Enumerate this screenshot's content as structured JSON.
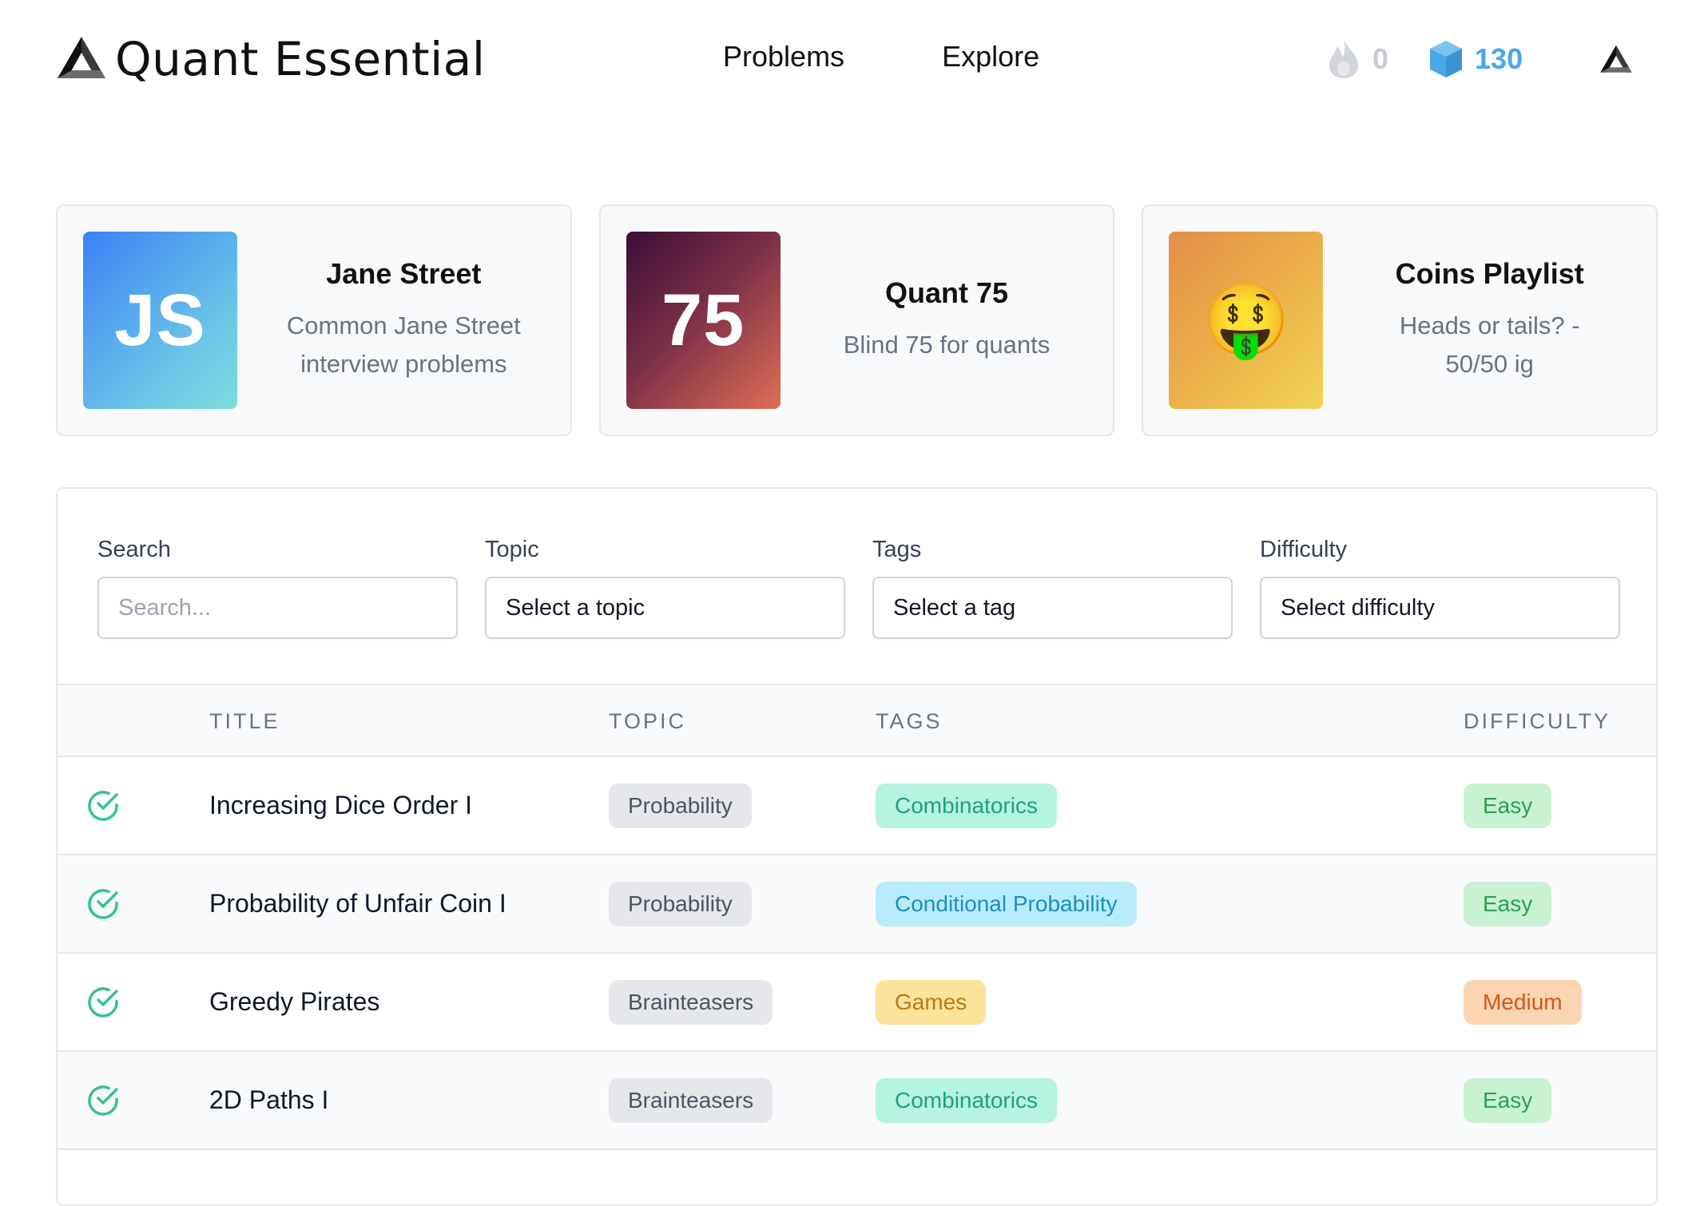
{
  "brand": {
    "name": "Quant Essential"
  },
  "nav": {
    "problems": "Problems",
    "explore": "Explore"
  },
  "stats": {
    "streak": "0",
    "gems": "130"
  },
  "cards": [
    {
      "thumb_text": "JS",
      "title": "Jane Street",
      "desc_line1": "Common Jane Street",
      "desc_line2": "interview problems"
    },
    {
      "thumb_text": "75",
      "title": "Quant 75",
      "desc_line1": "Blind 75 for quants",
      "desc_line2": ""
    },
    {
      "thumb_text": "🤑",
      "title": "Coins Playlist",
      "desc_line1": "Heads or tails? -",
      "desc_line2": "50/50 ig"
    }
  ],
  "filters": {
    "search": {
      "label": "Search",
      "placeholder": "Search..."
    },
    "topic": {
      "label": "Topic",
      "value": "Select a topic"
    },
    "tags": {
      "label": "Tags",
      "value": "Select a tag"
    },
    "difficulty": {
      "label": "Difficulty",
      "value": "Select difficulty"
    }
  },
  "table": {
    "headers": {
      "title": "TITLE",
      "topic": "TOPIC",
      "tags": "TAGS",
      "difficulty": "DIFFICULTY"
    },
    "rows": [
      {
        "title": "Increasing Dice Order I",
        "topic": "Probability",
        "tag": "Combinatorics",
        "difficulty": "Easy",
        "solved": true
      },
      {
        "title": "Probability of Unfair Coin I",
        "topic": "Probability",
        "tag": "Conditional Probability",
        "difficulty": "Easy",
        "solved": true
      },
      {
        "title": "Greedy Pirates",
        "topic": "Brainteasers",
        "tag": "Games",
        "difficulty": "Medium",
        "solved": true
      },
      {
        "title": "2D Paths I",
        "topic": "Brainteasers",
        "tag": "Combinatorics",
        "difficulty": "Easy",
        "solved": true
      }
    ]
  },
  "colors": {
    "check": "#34c38f",
    "gem": "#4aa8e8",
    "streak_inactive": "#c7cbd1"
  },
  "icons": {
    "brand": "penrose-triangle-icon",
    "streak": "flame-icon",
    "gems": "gem-icon",
    "solved": "check-circle-icon"
  }
}
